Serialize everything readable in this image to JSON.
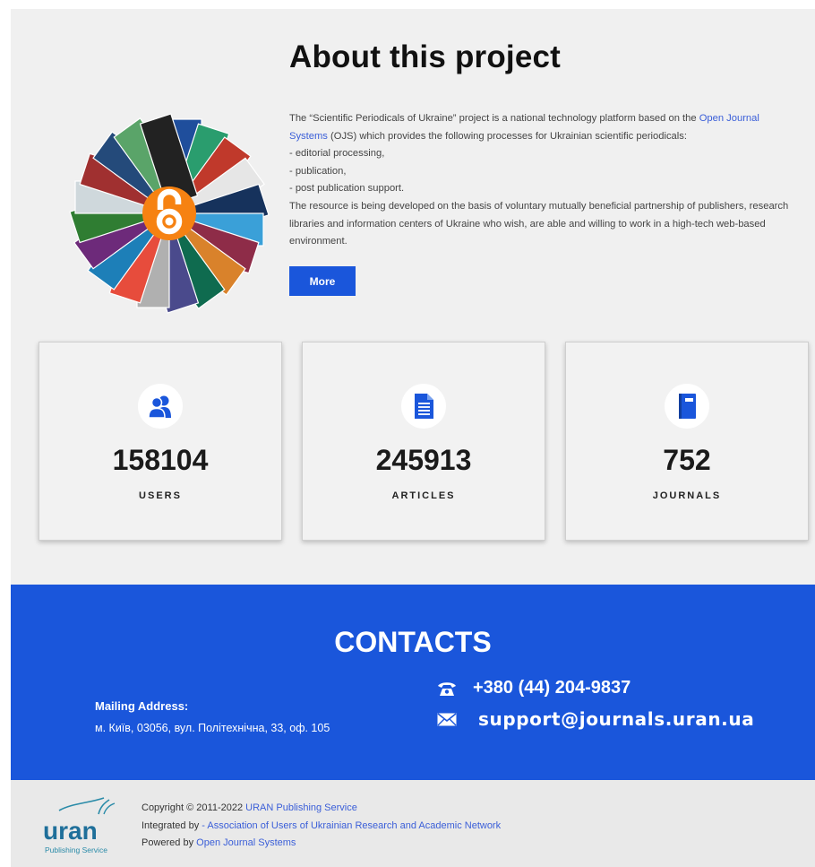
{
  "about": {
    "title": "About this project",
    "p1_pre": "The “Scientific Periodicals of Ukraine” project is a national technology platform based on the ",
    "ojs_link": "Open Journal Systems",
    "p1_post": " (OJS) which provides the following processes for Ukrainian scientific periodicals:",
    "list": [
      "- editorial processing,",
      "- publication,",
      "- post publication support."
    ],
    "p2": "The resource is being developed on the basis of voluntary mutually beneficial partnership of publishers, research libraries and information centers of Ukraine who wish, are able and willing to work in a high-tech web-based environment.",
    "more_label": "More"
  },
  "stats": [
    {
      "icon": "users-icon",
      "value": "158104",
      "label": "USERS"
    },
    {
      "icon": "document-icon",
      "value": "245913",
      "label": "ARTICLES"
    },
    {
      "icon": "journal-icon",
      "value": "752",
      "label": "JOURNALS"
    }
  ],
  "contacts": {
    "title": "CONTACTS",
    "mailing_label": "Mailing Address:",
    "mailing_address": "м. Київ, 03056, вул. Політехнічна, 33, оф. 105",
    "phone": "+380 (44) 204-9837",
    "email": "support@journals.uran.ua"
  },
  "footer": {
    "logo_text": "uran",
    "logo_sub": "Publishing Service",
    "copyright_pre": "Copyright © 2011-2022 ",
    "copyright_link": "URAN Publishing Service",
    "integrated_pre": "Integrated by ",
    "integrated_link": "- Association of Users of Ukrainian Research and Academic Network",
    "powered_pre": "Powered by ",
    "powered_link": "Open Journal Systems"
  },
  "colors": {
    "accent": "#1a56db",
    "link": "#3a5ed8",
    "oa_orange": "#f68212"
  }
}
